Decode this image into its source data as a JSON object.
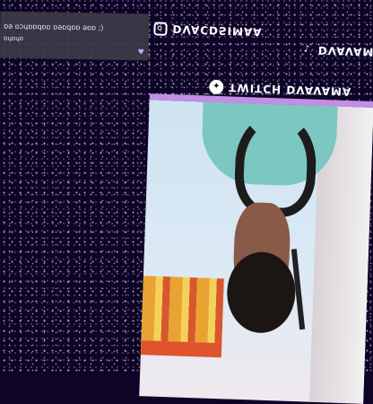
{
  "chat": {
    "line1": "ɒǝ ɒɔɥɒɒqɒɒ ɒǝɒqɒɒ ǝɒɒ ;)",
    "line2": "ɒɥɒɥɒ",
    "icon": "heart-icon"
  },
  "socials": {
    "instagram_handle": "DVACDSIMAA",
    "tiktok_handle": "DVAVAMA",
    "twitch_handle": "TWITCH DVAVAMA"
  },
  "colors": {
    "background": "#0d0428",
    "frame_accent": "#c38ee6",
    "chat_bg": "#3c3a46"
  }
}
